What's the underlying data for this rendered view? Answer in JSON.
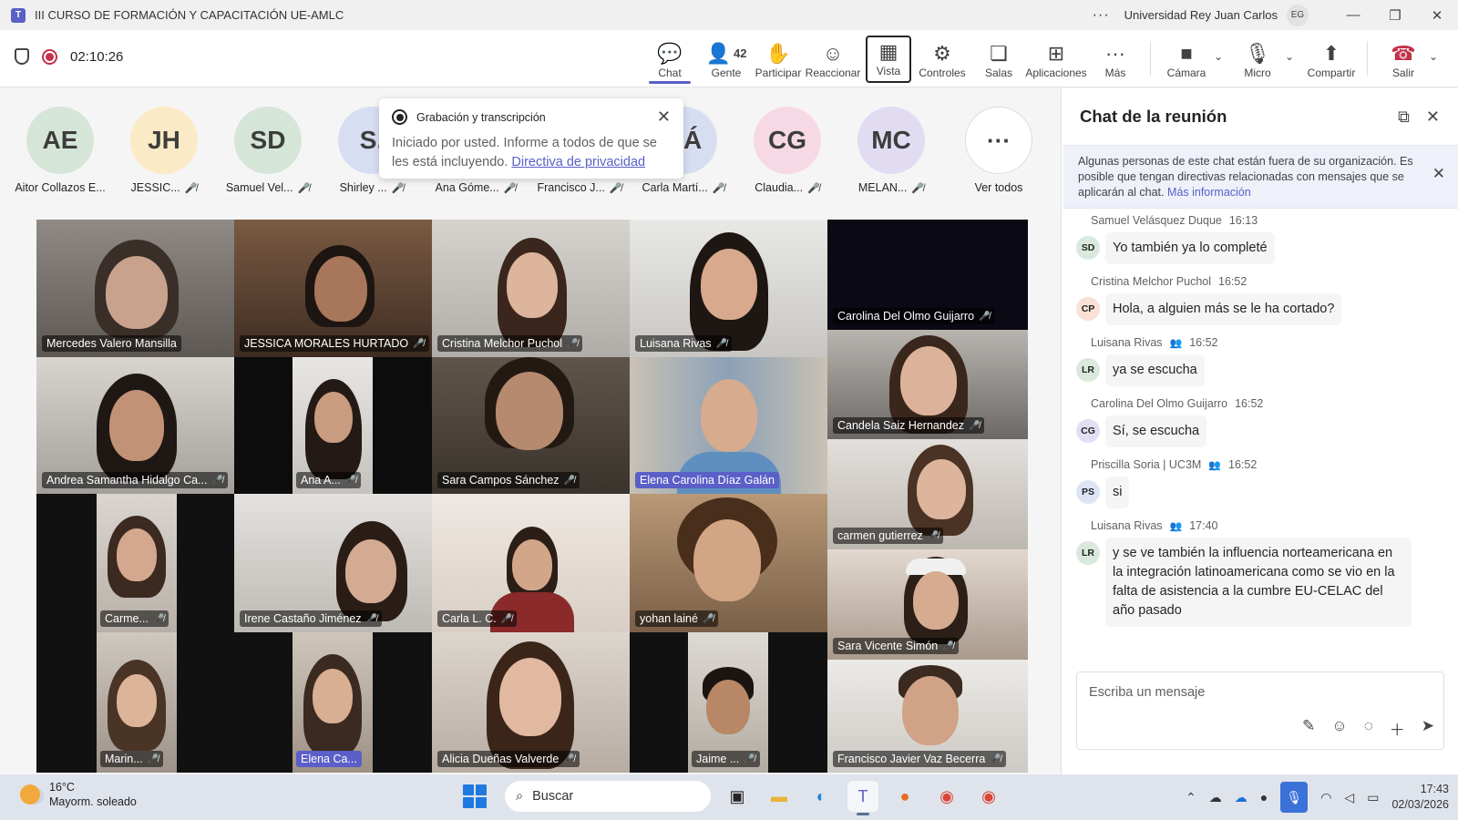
{
  "window": {
    "title": "III CURSO DE FORMACIÓN Y CAPACITACIÓN UE-AMLC",
    "org": "Universidad Rey Juan Carlos",
    "user_initials": "EG"
  },
  "toolbar": {
    "timer": "02:10:26",
    "chat": "Chat",
    "people": "Gente",
    "people_count": "42",
    "raise": "Participar",
    "react": "Reaccionar",
    "view": "Vista",
    "controls": "Controles",
    "rooms": "Salas",
    "apps": "Aplicaciones",
    "more": "Más",
    "camera": "Cámara",
    "mic": "Micro",
    "share": "Compartir",
    "leave": "Salir"
  },
  "participants_strip": [
    {
      "initials": "AE",
      "name": "Aitor Collazos E...",
      "color": "#d5e6d8"
    },
    {
      "initials": "JH",
      "name": "JESSIC...",
      "color": "#fbeac6"
    },
    {
      "initials": "SD",
      "name": "Samuel Vel...",
      "color": "#d5e6d8"
    },
    {
      "initials": "S.",
      "name": "Shirley ...",
      "color": "#d8def2"
    },
    {
      "initials": "",
      "name": "Ana Góme...",
      "color": "#ececec"
    },
    {
      "initials": "",
      "name": "Francisco J...",
      "color": "#ececec"
    },
    {
      "initials": "CÁ",
      "name": "Carla Martí...",
      "color": "#d8def2"
    },
    {
      "initials": "CG",
      "name": "Claudia...",
      "color": "#f7d9e6"
    },
    {
      "initials": "MC",
      "name": "MELAN...",
      "color": "#e1dcf2"
    }
  ],
  "see_all": "Ver todos",
  "popup": {
    "title": "Grabación y transcripción",
    "body": "Iniciado por usted. Informe a todos de que se les está incluyendo.",
    "link": "Directiva de privacidad"
  },
  "tiles": [
    {
      "name": "Mercedes Valero Mansilla"
    },
    {
      "name": "JESSICA MORALES HURTADO"
    },
    {
      "name": "Cristina Melchor Puchol"
    },
    {
      "name": "Luisana Rivas"
    },
    {
      "name": "Carolina Del Olmo Guijarro"
    },
    {
      "name": "Andrea Samantha Hidalgo Ca..."
    },
    {
      "name": "Ana A..."
    },
    {
      "name": "Sara Campos Sánchez"
    },
    {
      "name": "Elena Carolina Díaz Galán"
    },
    {
      "name": "Candela Saiz Hernandez"
    },
    {
      "name": "carmen gutierrez"
    },
    {
      "name": "Carme..."
    },
    {
      "name": "Irene Castaño Jiménez"
    },
    {
      "name": "Carla L. C."
    },
    {
      "name": "yohan lainé"
    },
    {
      "name": "Sara Vicente Simón"
    },
    {
      "name": "Marin..."
    },
    {
      "name": "Elena Ca..."
    },
    {
      "name": "Alicia Dueñas Valverde"
    },
    {
      "name": "Jaime ..."
    },
    {
      "name": "Francisco Javier Vaz Becerra"
    }
  ],
  "chat": {
    "title": "Chat de la reunión",
    "notice": "Algunas personas de este chat están fuera de su organización. Es posible que tengan directivas relacionadas con mensajes que se aplicarán al chat.",
    "notice_link": "Más información",
    "messages": [
      {
        "author": "Samuel Velásquez Duque",
        "time": "16:13",
        "initials": "SD",
        "text": "Yo también ya lo completé",
        "color": "#dbe8dc"
      },
      {
        "author": "Cristina Melchor Puchol",
        "time": "16:52",
        "initials": "CP",
        "text": "Hola, a alguien más se le ha cortado?",
        "color": "#fbe0d6"
      },
      {
        "author": "Luisana Rivas",
        "time": "16:52",
        "initials": "LR",
        "text": "ya se escucha",
        "color": "#dbe8dc"
      },
      {
        "author": "Carolina Del Olmo Guijarro",
        "time": "16:52",
        "initials": "CG",
        "text": "Sí, se escucha",
        "color": "#e3def3"
      },
      {
        "author": "Priscilla Soria | UC3M",
        "time": "16:52",
        "initials": "PS",
        "text": "si",
        "color": "#dde4f3"
      },
      {
        "author": "Luisana Rivas",
        "time": "17:40",
        "initials": "LR",
        "text": "y se ve también la influencia norteamericana en la integración latinoamericana como se vio en la falta de asistencia a la cumbre EU-CELAC del año pasado",
        "color": "#dbe8dc"
      }
    ],
    "placeholder": "Escriba un mensaje"
  },
  "taskbar": {
    "temp": "16°C",
    "weather": "Mayorm. soleado",
    "search": "Buscar",
    "time": "17:43",
    "date": "02/03/2026"
  }
}
